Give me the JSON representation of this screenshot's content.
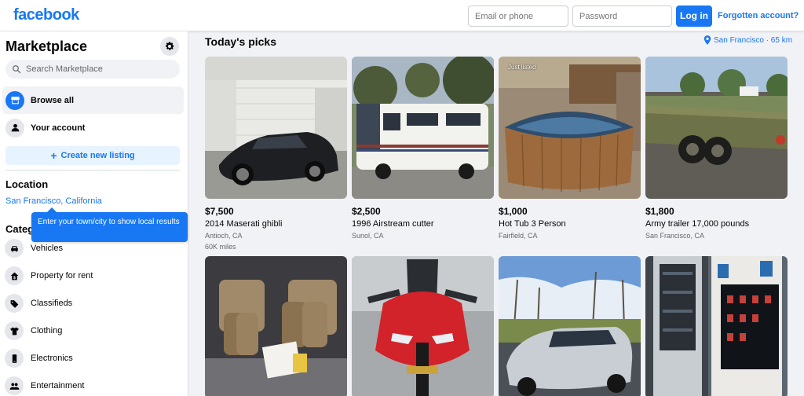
{
  "header": {
    "logo": "facebook",
    "email_placeholder": "Email or phone",
    "password_placeholder": "Password",
    "login_label": "Log in",
    "forgot_label": "Forgotten account?"
  },
  "sidebar": {
    "title": "Marketplace",
    "search_placeholder": "Search Marketplace",
    "nav": [
      {
        "label": "Browse all",
        "icon": "storefront-icon",
        "active": true
      },
      {
        "label": "Your account",
        "icon": "person-icon",
        "active": false
      }
    ],
    "create_label": "Create new listing",
    "location_heading": "Location",
    "location_value": "San Francisco, California",
    "tooltip": "Enter your town/city to show local results",
    "categories_heading": "Categories",
    "categories": [
      {
        "label": "Vehicles",
        "icon": "car-icon"
      },
      {
        "label": "Property for rent",
        "icon": "house-dollar-icon"
      },
      {
        "label": "Classifieds",
        "icon": "tag-icon"
      },
      {
        "label": "Clothing",
        "icon": "shirt-icon"
      },
      {
        "label": "Electronics",
        "icon": "phone-icon"
      },
      {
        "label": "Entertainment",
        "icon": "people-icon"
      }
    ]
  },
  "main": {
    "title": "Today's picks",
    "location_chip": "San Francisco · 65 km",
    "listings": [
      {
        "price": "$7,500",
        "title": "2014 Maserati ghibli",
        "location": "Antioch, CA",
        "extra": "60K miles",
        "image": "black-sedan-in-garage"
      },
      {
        "price": "$2,500",
        "title": "1996 Airstream cutter",
        "location": "Sunol, CA",
        "extra": "",
        "image": "white-motorhome"
      },
      {
        "price": "$1,000",
        "title": "Hot Tub 3 Person",
        "location": "Fairfield, CA",
        "extra": "",
        "image": "wooden-hot-tub",
        "overlay": "Just listed"
      },
      {
        "price": "$1,800",
        "title": "Army trailer 17,000 pounds",
        "location": "San Francisco, CA",
        "extra": "",
        "image": "olive-flatbed-trailer"
      },
      {
        "price": "",
        "title": "",
        "location": "",
        "extra": "",
        "image": "binoculars-and-cases"
      },
      {
        "price": "",
        "title": "",
        "location": "",
        "extra": "",
        "image": "red-sport-motorcycle"
      },
      {
        "price": "",
        "title": "",
        "location": "",
        "extra": "",
        "image": "silver-coupe"
      },
      {
        "price": "",
        "title": "",
        "location": "",
        "extra": "",
        "image": "vending-machine"
      }
    ]
  },
  "colors": {
    "brand": "#1877f2",
    "page_bg": "#f0f2f5",
    "text_secondary": "#65676b"
  }
}
